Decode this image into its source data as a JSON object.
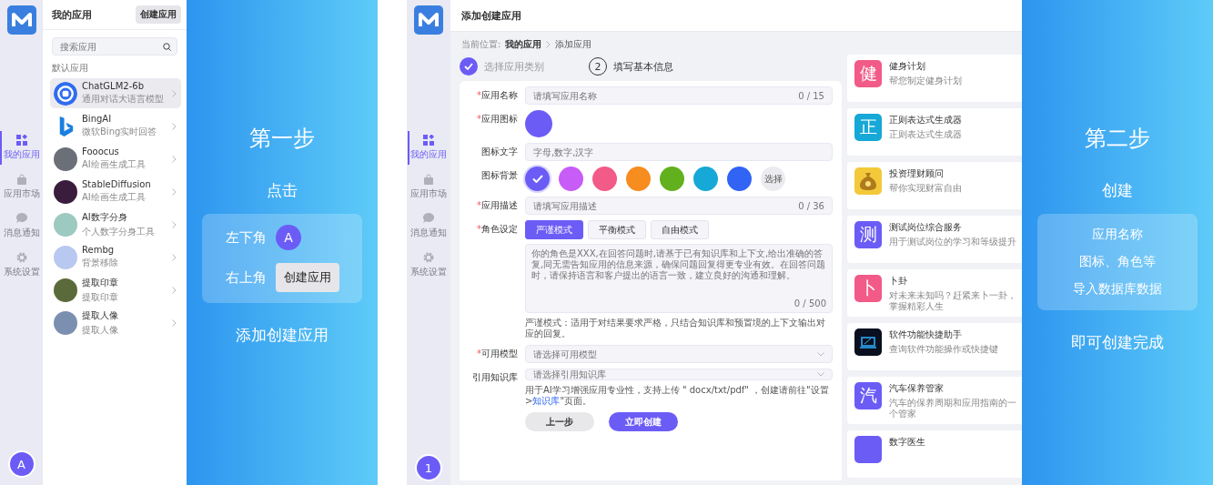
{
  "left_app": {
    "nav": [
      {
        "label": "我的应用",
        "selected": true
      },
      {
        "label": "应用市场",
        "selected": false
      },
      {
        "label": "消息通知",
        "selected": false
      },
      {
        "label": "系统设置",
        "selected": false
      }
    ],
    "avatar": "A",
    "title": "我的应用",
    "create_button": "创建应用",
    "search": {
      "placeholder": "搜索应用"
    },
    "section": "默认应用",
    "apps": [
      {
        "name": "ChatGLM2-6b",
        "desc": "通用对话大语言模型",
        "kind": "logo",
        "color": "#2f6cf0",
        "selected": true
      },
      {
        "name": "BingAI",
        "desc": "微软Bing实时回答",
        "kind": "bing",
        "color": "#1a7fe0",
        "selected": false
      },
      {
        "name": "Fooocus",
        "desc": "AI绘画生成工具",
        "kind": "photo",
        "color": "#6b6f78",
        "selected": false
      },
      {
        "name": "StableDiffusion",
        "desc": "AI绘画生成工具",
        "kind": "photo",
        "color": "#3a1c3c",
        "selected": false
      },
      {
        "name": "AI数字分身",
        "desc": "个人数字分身工具",
        "kind": "photo",
        "color": "#9cc9c0",
        "selected": false
      },
      {
        "name": "Rembg",
        "desc": "背景移除",
        "kind": "photo",
        "color": "#b9c8f0",
        "selected": false
      },
      {
        "name": "提取印章",
        "desc": "提取印章",
        "kind": "photo",
        "color": "#5a6a3a",
        "selected": false
      },
      {
        "name": "提取人像",
        "desc": "提取人像",
        "kind": "photo",
        "color": "#7b8fb0",
        "selected": false
      }
    ]
  },
  "step1": {
    "title": "第一步",
    "action": "点击",
    "rows": [
      {
        "label": "左下角",
        "kind": "avatar",
        "value": "A"
      },
      {
        "label": "右上角",
        "kind": "button",
        "value": "创建应用"
      }
    ],
    "footer": "添加创建应用"
  },
  "mid_app": {
    "nav": [
      {
        "label": "我的应用",
        "selected": true
      },
      {
        "label": "应用市场",
        "selected": false
      },
      {
        "label": "消息通知",
        "selected": false
      },
      {
        "label": "系统设置",
        "selected": false
      }
    ],
    "badge": "1",
    "title": "添加创建应用",
    "breadcrumb": {
      "prefix": "当前位置:",
      "parent": "我的应用",
      "current": "添加应用"
    },
    "steps": [
      {
        "label": "选择应用类别",
        "done": true
      },
      {
        "number": "2",
        "label": "填写基本信息",
        "done": false
      }
    ],
    "form": {
      "name": {
        "marker": "*",
        "label": "应用名称",
        "placeholder": "请填写应用名称",
        "count": "0 / 15"
      },
      "icon": {
        "marker": "*",
        "label": "应用图标",
        "color": "#6c5cf6"
      },
      "icon_text": {
        "label": "图标文字",
        "placeholder": "字母,数字,汉字"
      },
      "icon_bg": {
        "label": "图标背景",
        "choose": "选择",
        "swatches": [
          {
            "color": "#6c5cf6",
            "selected": true
          },
          {
            "color": "#c85cf7",
            "selected": false
          },
          {
            "color": "#f25a87",
            "selected": false
          },
          {
            "color": "#f78c1f",
            "selected": false
          },
          {
            "color": "#63b01e",
            "selected": false
          },
          {
            "color": "#16a8d6",
            "selected": false
          },
          {
            "color": "#3164f5",
            "selected": false
          }
        ]
      },
      "desc": {
        "marker": "*",
        "label": "应用描述",
        "placeholder": "请填写应用描述",
        "count": "0 / 36"
      },
      "role": {
        "marker": "*",
        "label": "角色设定",
        "modes": [
          {
            "label": "严谨模式",
            "selected": true
          },
          {
            "label": "平衡模式",
            "selected": false
          },
          {
            "label": "自由模式",
            "selected": false
          }
        ],
        "placeholder": "你的角色是XXX,在回答问题时,请基于已有知识库和上下文,给出准确的答复,同无需告知应用的信息来源，确保问题回复得更专业有效。在回答问题时，请保持语言和客户提出的语言一致，建立良好的沟通和理解。",
        "count": "0 / 500",
        "hint": "严谨模式：适用于对结果要求严格，只结合知识库和预置境的上下文输出对应的回复。"
      },
      "model": {
        "marker": "*",
        "label": "可用模型",
        "placeholder": "请选择可用模型"
      },
      "kb": {
        "label": "引用知识库",
        "placeholder": "请选择引用知识库",
        "hint_before": "用于AI学习增强应用专业性，支持上传 \" docx/txt/pdf\" ，创建请前往\"设置>",
        "hint_link": "知识库",
        "hint_after": "\"页面。"
      },
      "back": "上一步",
      "submit": "立即创建"
    },
    "templates": [
      {
        "title": "健身计划",
        "desc": "帮您制定健身计划",
        "kind": "letter",
        "letter": "健",
        "color": "#f25a87"
      },
      {
        "title": "正则表达式生成器",
        "desc": "正则表达式生成器",
        "kind": "letter",
        "letter": "正",
        "color": "#16a8d6"
      },
      {
        "title": "投资理财顾问",
        "desc": "帮你实现财富自由",
        "kind": "image",
        "color": "#f3c93a"
      },
      {
        "title": "测试岗位综合服务",
        "desc": "用于测试岗位的学习和等级提升",
        "kind": "letter",
        "letter": "测",
        "color": "#6c5cf6"
      },
      {
        "title": "卜卦",
        "desc": "对未来未知吗？赶紧来卜一卦，掌握精彩人生",
        "kind": "letter",
        "letter": "卜",
        "color": "#f25a87"
      },
      {
        "title": "软件功能快捷助手",
        "desc": "查询软件功能操作或快捷键",
        "kind": "laptop",
        "color": "#0b1020"
      },
      {
        "title": "汽车保养管家",
        "desc": "汽车的保养周期和应用指南的一个管家",
        "kind": "letter",
        "letter": "汽",
        "color": "#6c5cf6"
      },
      {
        "title": "数字医生",
        "kind": "blank",
        "color": "#6c5cf6"
      }
    ]
  },
  "step2": {
    "title": "第二步",
    "action": "创建",
    "lines": [
      "应用名称",
      "图标、角色等",
      "导入数据库数据"
    ],
    "footer": "即可创建完成"
  }
}
